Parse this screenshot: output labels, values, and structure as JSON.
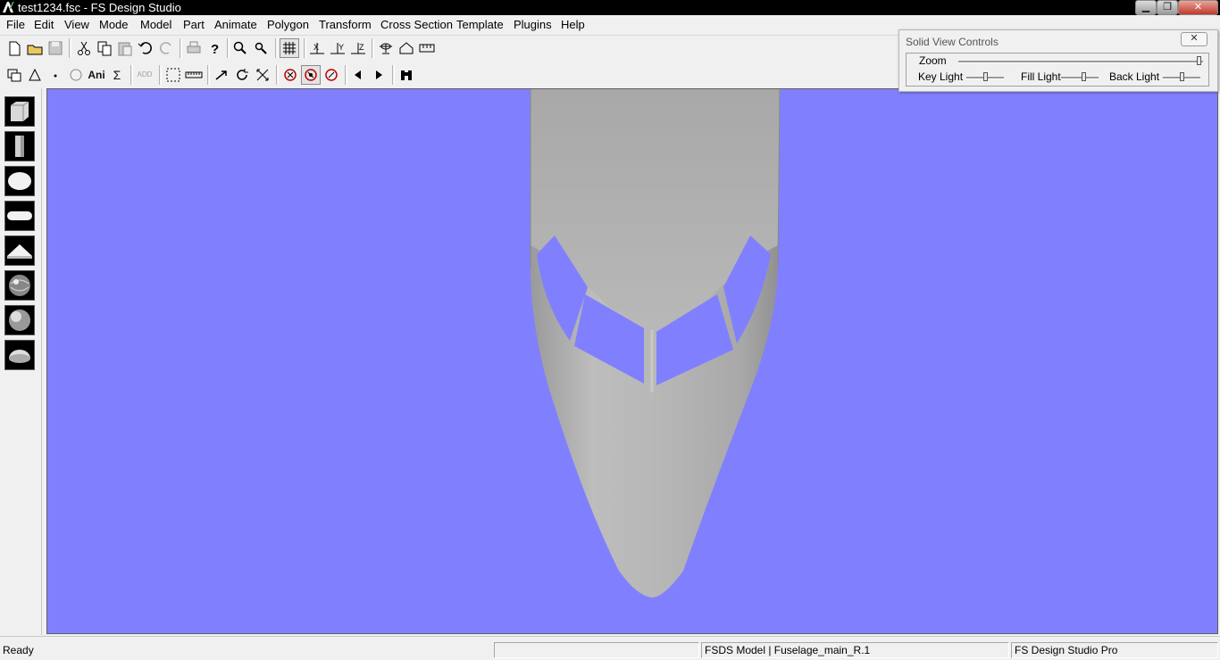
{
  "window": {
    "title": "test1234.fsc - FS Design Studio",
    "minimize": "▁",
    "maximize": "❐",
    "close": "✕"
  },
  "menu": [
    "File",
    "Edit",
    "View",
    "Mode",
    "Model",
    "Part",
    "Animate",
    "Polygon",
    "Transform",
    "Cross Section",
    "Template",
    "Plugins",
    "Help"
  ],
  "toolbar1": {
    "icons": [
      "new-icon",
      "open-icon",
      "save-icon",
      "cut-icon",
      "copy-icon",
      "paste-icon",
      "undo-icon",
      "redo-icon",
      "print-icon",
      "help-icon",
      "zoom-in-icon",
      "zoom-out-icon",
      "grid-icon",
      "flip-x-icon",
      "flip-y-icon",
      "flip-z-icon",
      "balance-icon",
      "home-icon",
      "measure-icon"
    ]
  },
  "toolbar2": {
    "icons": [
      "copy-poly-icon",
      "triangle-icon",
      "point-icon",
      "circle-icon",
      "ani-label",
      "sigma-icon",
      "add-label",
      "select-box-icon",
      "ruler-icon",
      "arrow-icon",
      "rotate-icon",
      "scale-icon",
      "cancel-icon",
      "cancel-pressed-icon",
      "cancel-slash-icon",
      "prev-icon",
      "next-icon",
      "binoculars-icon"
    ],
    "ani_label": "Ani",
    "sigma_label": "Σ",
    "add_label": "ADD"
  },
  "shapes": [
    "box-shape-icon",
    "cylinder-shape-icon",
    "sphere-shape-icon",
    "capsule-shape-icon",
    "cone-shape-icon",
    "textured-sphere-icon",
    "shaded-sphere-icon",
    "half-sphere-icon"
  ],
  "solid_view_controls": {
    "title": "Solid View Controls",
    "close": "✕",
    "zoom_label": "Zoom",
    "zoom_value": 0.98,
    "key_light_label": "Key Light",
    "key_light_value": 0.5,
    "fill_light_label": "Fill Light",
    "fill_light_value": 0.6,
    "back_light_label": "Back Light",
    "back_light_value": 0.5
  },
  "viewport": {
    "background_color": "#8080ff",
    "model_color": "#b0b0b0"
  },
  "status": {
    "ready": "Ready",
    "model": "FSDS Model | Fuselage_main_R.1",
    "product": "FS Design Studio Pro"
  }
}
